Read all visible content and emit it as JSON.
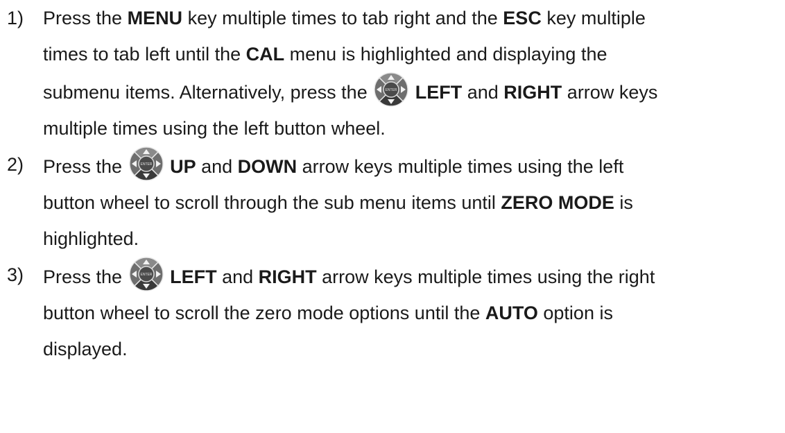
{
  "steps": [
    {
      "number": "1)",
      "lines": [
        [
          "Press the ",
          {
            "b": "MENU"
          },
          " key multiple times to tab right and the ",
          {
            "b": "ESC"
          },
          " key multiple"
        ],
        [
          "times to tab left until the ",
          {
            "b": "CAL"
          },
          " menu is highlighted and displaying the"
        ],
        [
          "submenu items.  Alternatively, press the ",
          {
            "icon": "button-wheel-icon"
          },
          " ",
          {
            "b": "LEFT"
          },
          " and ",
          {
            "b": "RIGHT"
          },
          " arrow keys"
        ],
        [
          "multiple times using the left button wheel."
        ]
      ]
    },
    {
      "number": "2)",
      "lines": [
        [
          "Press the ",
          {
            "icon": "button-wheel-icon"
          },
          " ",
          {
            "b": "UP"
          },
          " and ",
          {
            "b": "DOWN"
          },
          " arrow keys multiple times using the left"
        ],
        [
          "button wheel to scroll through the sub menu items until ",
          {
            "b": "ZERO MODE"
          },
          " is"
        ],
        [
          "highlighted."
        ]
      ]
    },
    {
      "number": "3)",
      "lines": [
        [
          "Press the ",
          {
            "icon": "button-wheel-icon"
          },
          " ",
          {
            "b": "LEFT"
          },
          " and ",
          {
            "b": "RIGHT"
          },
          " arrow keys multiple times using the right"
        ],
        [
          "button wheel to scroll the zero mode options until the ",
          {
            "b": "AUTO"
          },
          " option is"
        ],
        [
          "displayed."
        ]
      ]
    }
  ],
  "wheel_center_label": "ENTER"
}
